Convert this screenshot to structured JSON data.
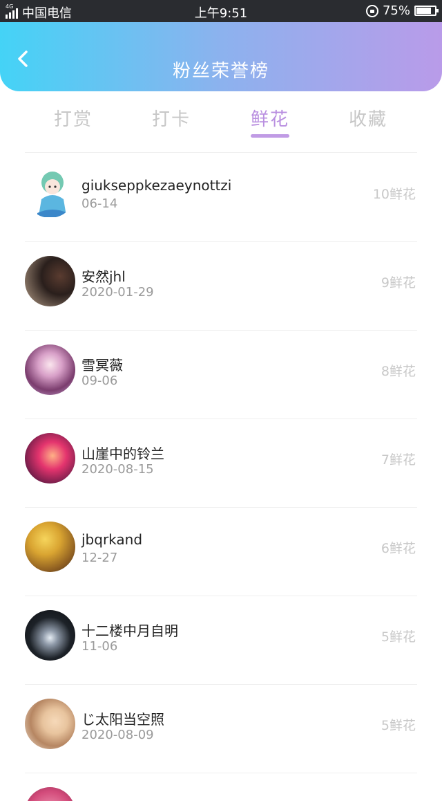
{
  "status_bar": {
    "network": "4G",
    "carrier": "中国电信",
    "time": "上午9:51",
    "battery": "75%"
  },
  "header": {
    "title": "粉丝荣誉榜",
    "back_icon": "chevron-left-icon"
  },
  "tabs": [
    {
      "label": "打赏",
      "active": false
    },
    {
      "label": "打卡",
      "active": false
    },
    {
      "label": "鲜花",
      "active": true
    },
    {
      "label": "收藏",
      "active": false
    }
  ],
  "colors": {
    "accent": "#b98fe0",
    "header_gradient_start": "#44d3f6",
    "header_gradient_end": "#b99be9"
  },
  "list": [
    {
      "name": "giukseppkezaeynottzi",
      "date": "06-14",
      "count": "10鲜花"
    },
    {
      "name": "安然jhl",
      "date": "2020-01-29",
      "count": "9鲜花"
    },
    {
      "name": "雪冥薇",
      "date": "09-06",
      "count": "8鲜花"
    },
    {
      "name": "山崖中的铃兰",
      "date": "2020-08-15",
      "count": "7鲜花"
    },
    {
      "name": "jbqrkand",
      "date": "12-27",
      "count": "6鲜花"
    },
    {
      "name": "十二楼中月自明",
      "date": "11-06",
      "count": "5鲜花"
    },
    {
      "name": "じ太阳当空照",
      "date": "2020-08-09",
      "count": "5鲜花"
    }
  ]
}
